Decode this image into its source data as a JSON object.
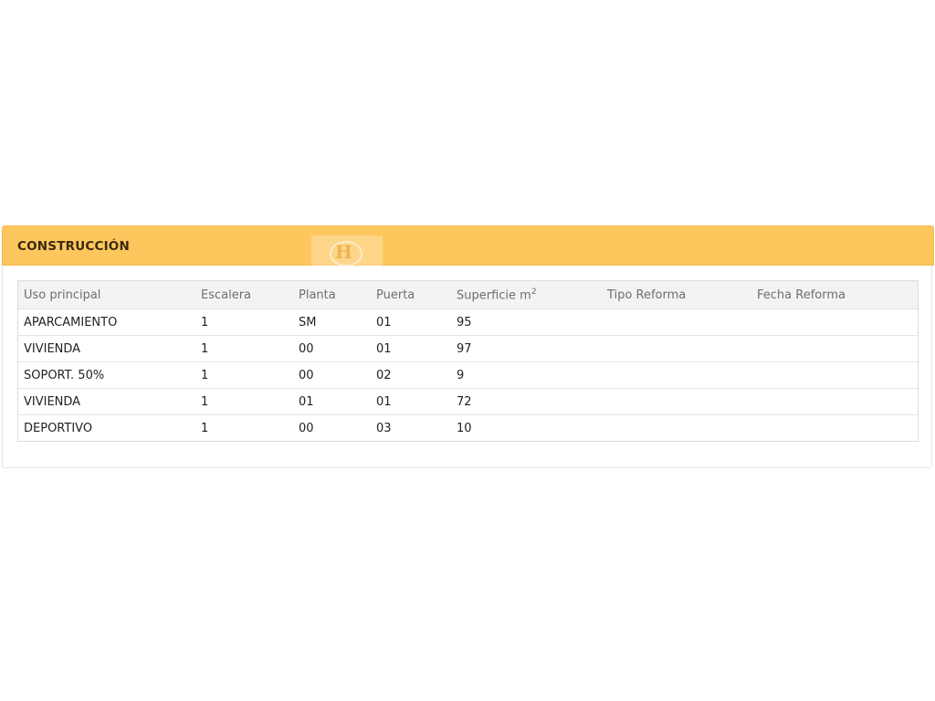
{
  "section": {
    "title": "CONSTRUCCIÓN",
    "logo_text": "H"
  },
  "table": {
    "headers": {
      "uso": "Uso principal",
      "escalera": "Escalera",
      "planta": "Planta",
      "puerta": "Puerta",
      "superficie": "Superficie m",
      "superficie_exp": "2",
      "tipo_reforma": "Tipo Reforma",
      "fecha_reforma": "Fecha Reforma"
    },
    "rows": [
      {
        "uso": "APARCAMIENTO",
        "escalera": "1",
        "planta": "SM",
        "puerta": "01",
        "superficie": "95",
        "tipo_reforma": "",
        "fecha_reforma": ""
      },
      {
        "uso": "VIVIENDA",
        "escalera": "1",
        "planta": "00",
        "puerta": "01",
        "superficie": "97",
        "tipo_reforma": "",
        "fecha_reforma": ""
      },
      {
        "uso": "SOPORT. 50%",
        "escalera": "1",
        "planta": "00",
        "puerta": "02",
        "superficie": "9",
        "tipo_reforma": "",
        "fecha_reforma": ""
      },
      {
        "uso": "VIVIENDA",
        "escalera": "1",
        "planta": "01",
        "puerta": "01",
        "superficie": "72",
        "tipo_reforma": "",
        "fecha_reforma": ""
      },
      {
        "uso": "DEPORTIVO",
        "escalera": "1",
        "planta": "00",
        "puerta": "03",
        "superficie": "10",
        "tipo_reforma": "",
        "fecha_reforma": ""
      }
    ]
  },
  "colors": {
    "header_bg": "#fdc75e",
    "title_text": "#3b2a0c",
    "table_header_bg": "#f3f3f3"
  }
}
